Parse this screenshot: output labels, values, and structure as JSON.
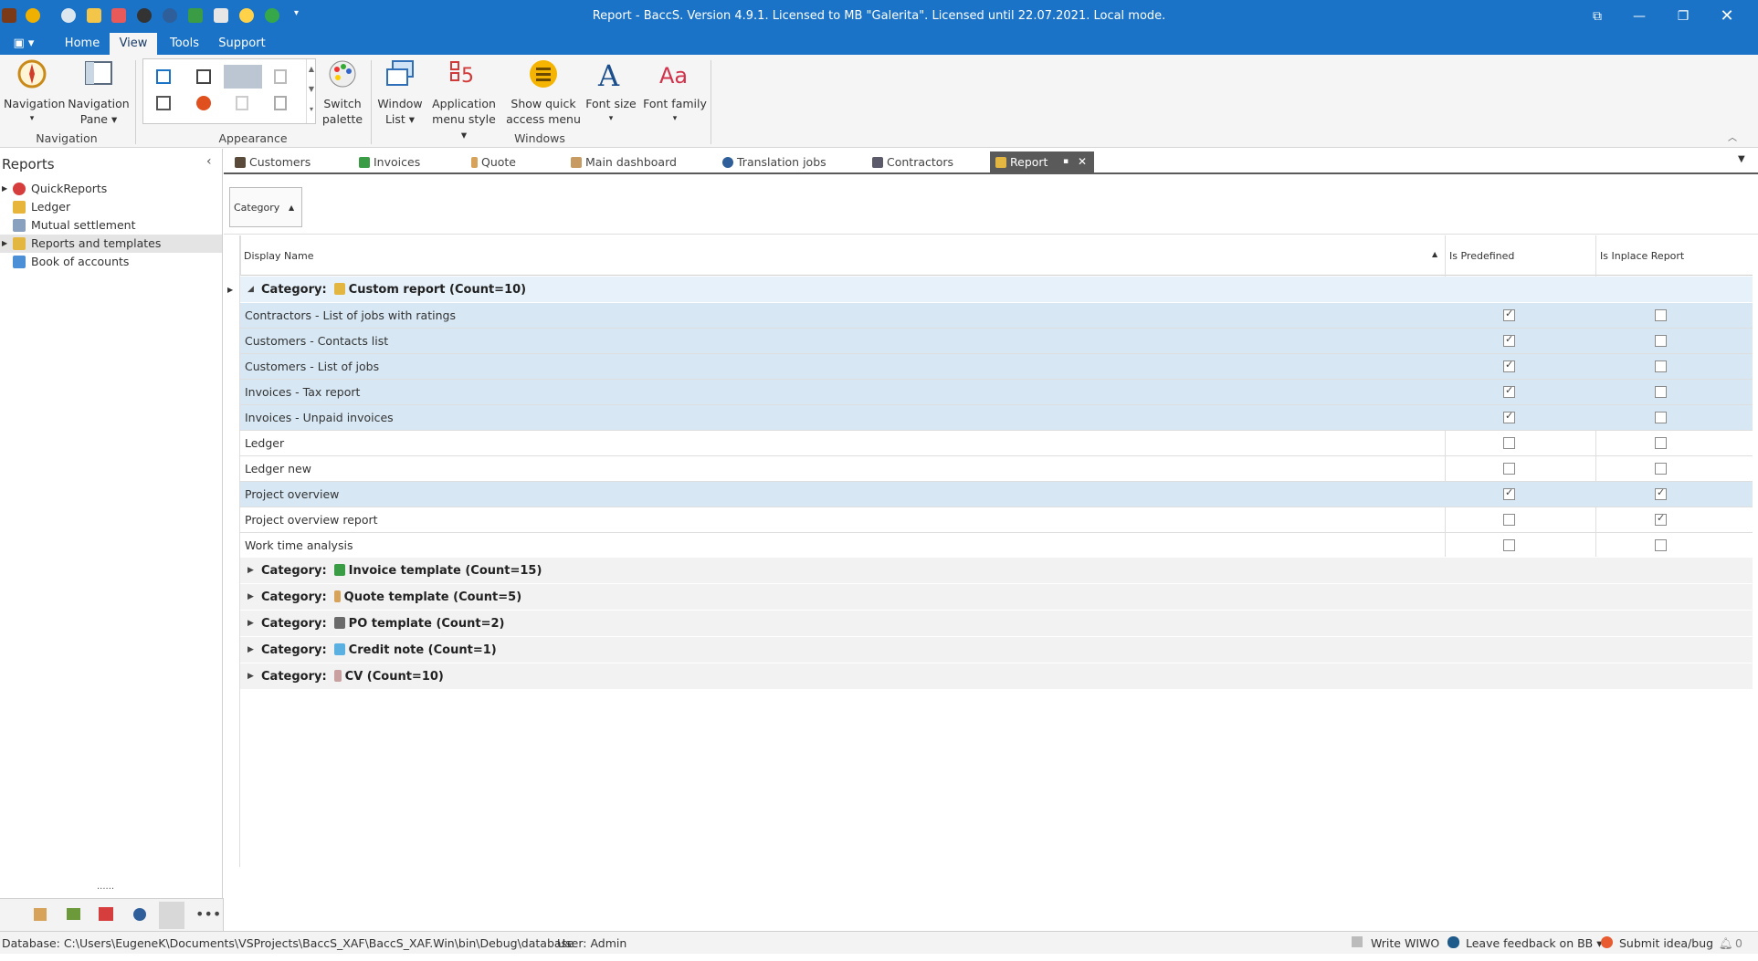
{
  "window": {
    "title": "Report - BaccS. Version 4.9.1. Licensed to MB \"Galerita\". Licensed until 22.07.2021. Local mode."
  },
  "ribbon_tabs": [
    "Home",
    "View",
    "Tools",
    "Support"
  ],
  "ribbon": {
    "navigation_btn": [
      "Navigation",
      "▾"
    ],
    "navigation_pane_btn": [
      "Navigation",
      "Pane ▾"
    ],
    "switch_palette_btn": [
      "Switch",
      "palette"
    ],
    "window_list_btn": [
      "Window",
      "List ▾"
    ],
    "app_menu_style_btn": [
      "Application",
      "menu style ▾"
    ],
    "quick_access_btn": [
      "Show quick",
      "access menu"
    ],
    "font_size_btn": [
      "Font size",
      "▾"
    ],
    "font_family_btn": [
      "Font family",
      "▾"
    ],
    "groups": [
      "Navigation",
      "Appearance",
      "Windows"
    ]
  },
  "sidenav": {
    "title": "Reports",
    "items": [
      "QuickReports",
      "Ledger",
      "Mutual settlement",
      "Reports and templates",
      "Book of accounts"
    ],
    "more": "......"
  },
  "doc_tabs": [
    "Customers",
    "Invoices",
    "Quote",
    "Main dashboard",
    "Translation jobs",
    "Contractors",
    "Report"
  ],
  "grid": {
    "group_panel_label": "Category",
    "columns": [
      "Display Name",
      "Is Predefined",
      "Is Inplace Report"
    ],
    "category_prefix": "Category:",
    "expanded_group": "Custom report (Count=10)",
    "rows": [
      {
        "name": "Contractors - List of jobs with ratings",
        "predefined": true,
        "inplace": false
      },
      {
        "name": "Customers - Contacts list",
        "predefined": true,
        "inplace": false
      },
      {
        "name": "Customers - List of jobs",
        "predefined": true,
        "inplace": false
      },
      {
        "name": "Invoices - Tax report",
        "predefined": true,
        "inplace": false
      },
      {
        "name": "Invoices - Unpaid invoices",
        "predefined": true,
        "inplace": false
      },
      {
        "name": "Ledger",
        "predefined": false,
        "inplace": false
      },
      {
        "name": "Ledger new",
        "predefined": false,
        "inplace": false
      },
      {
        "name": "Project overview",
        "predefined": true,
        "inplace": true
      },
      {
        "name": "Project overview report",
        "predefined": false,
        "inplace": true
      },
      {
        "name": "Work time analysis",
        "predefined": false,
        "inplace": false
      }
    ],
    "collapsed_groups": [
      "Invoice template (Count=15)",
      "Quote template (Count=5)",
      "PO template (Count=2)",
      "Credit note (Count=1)",
      "CV (Count=10)"
    ]
  },
  "statusbar": {
    "database": "Database: C:\\Users\\EugeneK\\Documents\\VSProjects\\BaccS_XAF\\BaccS_XAF.Win\\bin\\Debug\\database",
    "user": "User: Admin",
    "write_wiwo": "Write WIWO",
    "feedback": "Leave feedback on BB ▾",
    "submit_idea": "Submit idea/bug",
    "notifications": "0"
  }
}
